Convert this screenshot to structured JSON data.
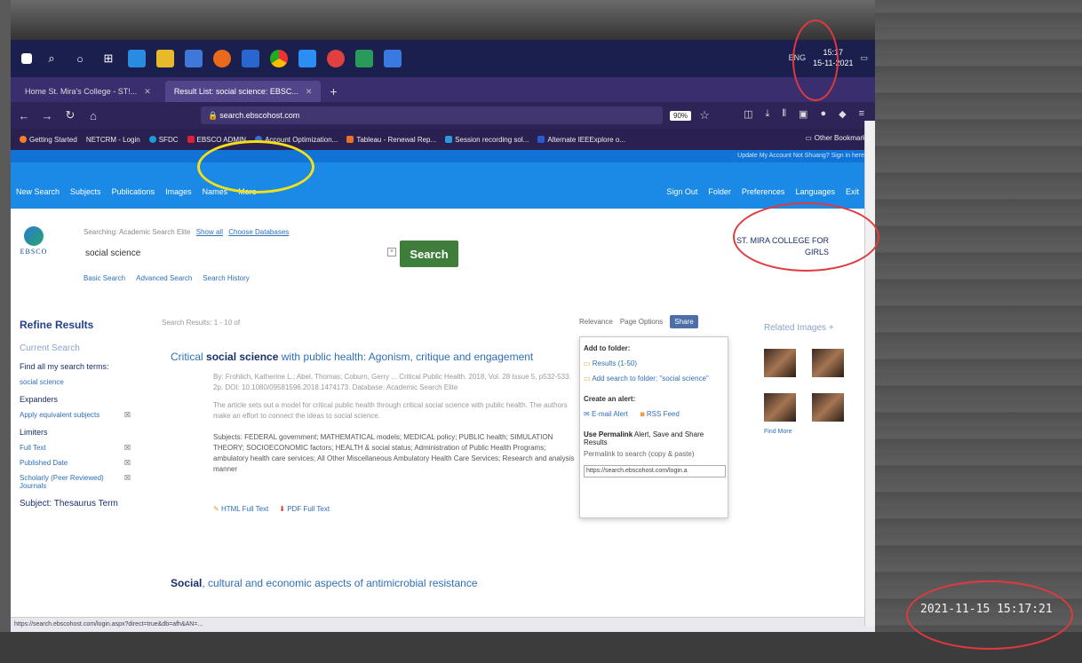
{
  "taskbar": {
    "icons": [
      "windows-start",
      "search",
      "cortana",
      "task-view",
      "app-a",
      "app-b",
      "app-c",
      "firefox",
      "app-d",
      "chrome",
      "app-e",
      "app-f",
      "app-g",
      "app-h"
    ],
    "tray_text": "ENG",
    "tray_time": "15:17",
    "tray_date": "15-11-2021"
  },
  "browser": {
    "tabs": [
      {
        "label": "Home St. Mira's College - ST!..."
      },
      {
        "label": "Result List: social science: EBSC..."
      }
    ],
    "url_prefix": "search.ebscohost.com",
    "zoom": "90%",
    "bookmarks": [
      "Getting Started",
      "NETCRM - Login",
      "SFDC",
      "EBSCO ADMIN",
      "Account Optimization...",
      "Tableau - Renewal Rep...",
      "Session recording sol...",
      "Alternate IEEExplore o..."
    ],
    "other_bookmarks": "Other Bookmarks"
  },
  "ebsco": {
    "top_links": "Update My Account  Not Shuang? Sign in here",
    "nav": [
      "New Search",
      "Subjects",
      "Publications",
      "Images",
      "Names",
      "More"
    ],
    "nav_right": [
      "Sign Out",
      "Folder",
      "Preferences",
      "Languages",
      "Exit"
    ],
    "logo": "EBSCO",
    "search_info": "Searching: Academic Search Elite",
    "show_all": "Show all",
    "choose_db": "Choose Databases",
    "search_value": "social science",
    "search_button": "Search",
    "search_links": [
      "Basic Search",
      "Advanced Search",
      "Search History"
    ],
    "institution": "ST. MIRA COLLEGE FOR GIRLS"
  },
  "refine": {
    "title": "Refine Results",
    "current_search": "Current Search",
    "find_all": "Find all my search terms:",
    "term": "social science",
    "expanders": "Expanders",
    "expander_item": "Apply equivalent subjects",
    "limiters": "Limiters",
    "limiter_items": [
      "Full Text",
      "Published Date",
      "Scholarly (Peer Reviewed) Journals"
    ],
    "subject_thesaurus": "Subject: Thesaurus Term"
  },
  "results": {
    "count": "Search Results: 1 - 10 of",
    "toolbar": [
      "Relevance",
      "Page Options",
      "Share"
    ],
    "items": [
      {
        "title_pre": "Critical ",
        "title_bold": "social science",
        "title_post": " with public health: Agonism, critique and engagement",
        "meta": "By: Frohlich, Katherine L.; Abel, Thomas; Coburn, Gerry ... Critical Public Health. 2018, Vol. 28 Issue 5, p532-533. 2p. DOI: 10.1080/09581596.2018.1474173. Database: Academic Search Elite",
        "abstract": "The article sets out a model for critical public health through critical social science with public health. The authors make an effort to connect the ideas to social science.",
        "subjects": "Subjects: FEDERAL government; MATHEMATICAL models; MEDICAL policy; PUBLIC health; SIMULATION THEORY; SOCIOECONOMIC factors; HEALTH & social status; Administration of Public Health Programs; ambulatory health care services; All Other Miscellaneous Ambulatory Health Care Services; Research and analysis manner",
        "html": "HTML Full Text",
        "pdf": "PDF Full Text"
      },
      {
        "title_pre": "",
        "title_bold": "Social",
        "title_post": ", cultural and economic aspects of antimicrobial resistance"
      }
    ]
  },
  "share": {
    "add_to_folder": "Add to folder:",
    "results_link": "Results (1-50)",
    "add_search": "Add search to folder: \"social science\"",
    "create_alert": "Create an alert:",
    "email_alert": "E-mail Alert",
    "rss": "RSS Feed",
    "use_permalink": "Use Permalink",
    "permalink_desc": "Alert, Save and Share Results",
    "permalink_hint": "Permalink to search (copy & paste)",
    "permalink_value": "https://search.ebscohost.com/login.a"
  },
  "related": {
    "title": "Related Images",
    "find_more": "Find More"
  },
  "status_url": "https://search.ebscohost.com/login.aspx?direct=true&db=afh&AN=...",
  "photo_stamp": "2021-11-15 15:17:21",
  "colors": {
    "ebsco_blue": "#1a8ae6",
    "search_green": "#3e7d3a",
    "annotation_red": "#e0393e",
    "annotation_yellow": "#f3e017"
  }
}
